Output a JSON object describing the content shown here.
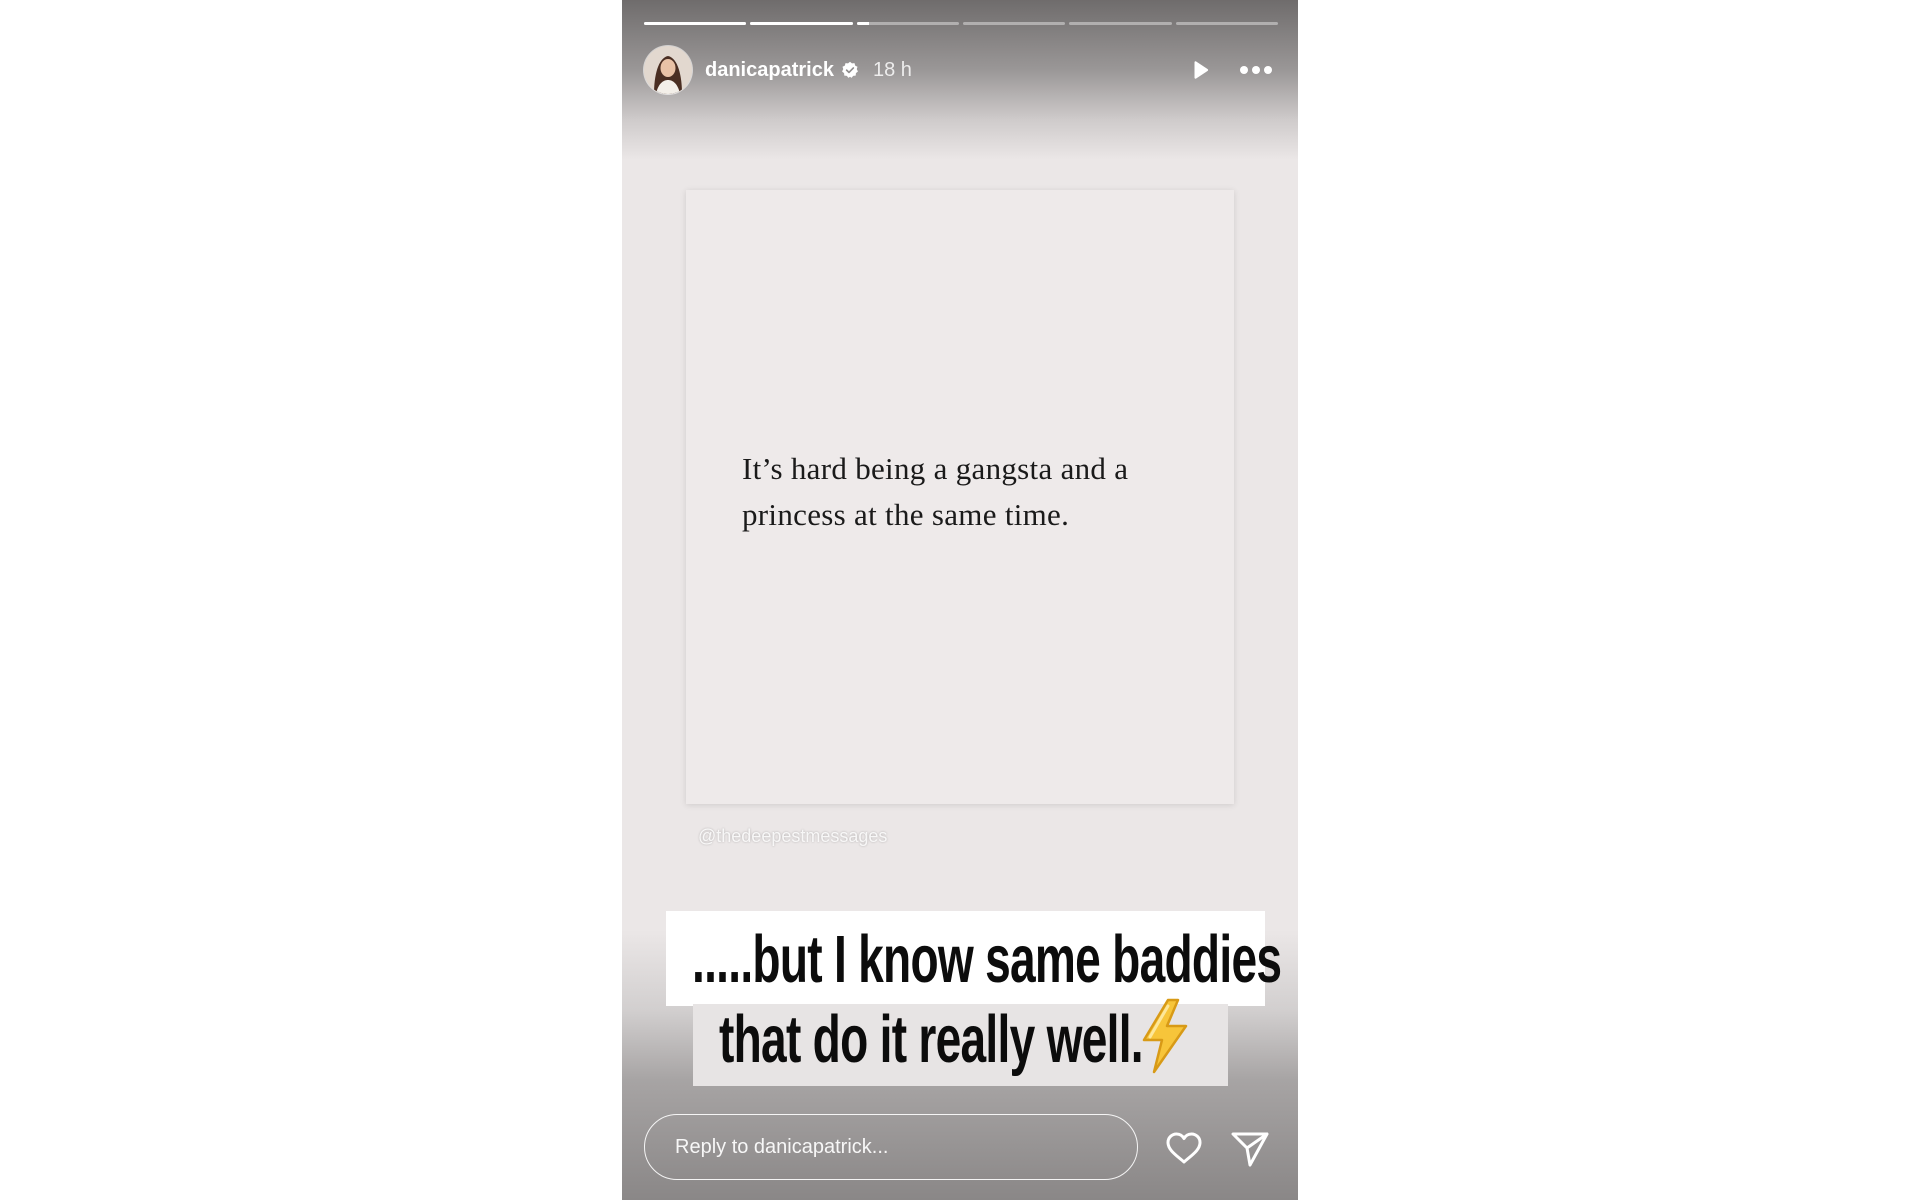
{
  "story": {
    "segments": [
      {
        "progress": 1.0
      },
      {
        "progress": 1.0
      },
      {
        "progress": 0.12
      },
      {
        "progress": 0.0
      },
      {
        "progress": 0.0
      },
      {
        "progress": 0.0
      }
    ],
    "header": {
      "username": "danicapatrick",
      "verified": true,
      "time": "18 h",
      "play_icon": "play-icon",
      "more_icon": "more-icon"
    },
    "card": {
      "quote": "It’s hard being a gangsta and a princess at the same time."
    },
    "watermark": "@thedeepestmessages",
    "caption": {
      "line1": ".....but I know same baddies",
      "line2": "that do it really well.",
      "emoji_icon": "lightning-bolt-icon"
    },
    "reply": {
      "placeholder": "Reply to danicapatrick..."
    },
    "actions": {
      "like_icon": "heart-icon",
      "share_icon": "send-icon"
    }
  },
  "colors": {
    "page_bg": "#ffffff",
    "card_bg": "#eeeaea",
    "text_dark": "#1a1a1a",
    "overlay_white": "#ffffff"
  }
}
